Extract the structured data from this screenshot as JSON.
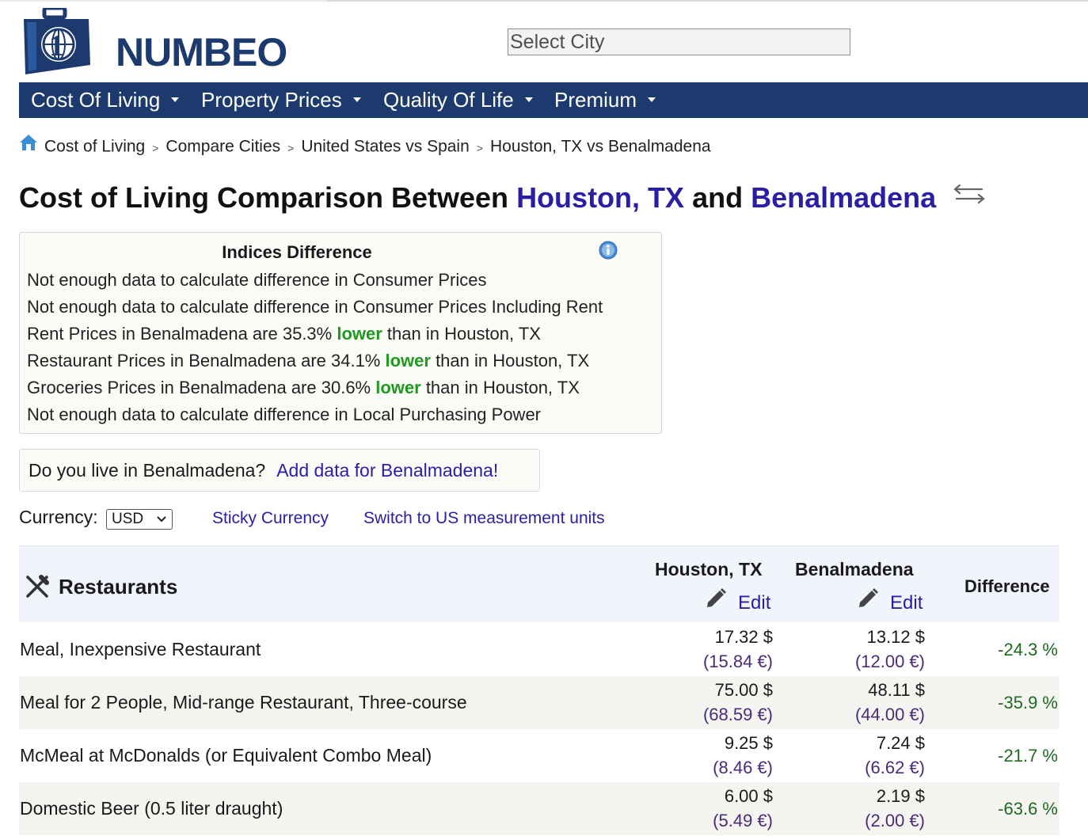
{
  "header": {
    "logo_text": "NUMBEO",
    "search_placeholder": "Select City"
  },
  "nav": {
    "items": [
      {
        "label": "Cost Of Living"
      },
      {
        "label": "Property Prices"
      },
      {
        "label": "Quality Of Life"
      },
      {
        "label": "Premium"
      }
    ]
  },
  "breadcrumb": {
    "items": [
      "Cost of Living",
      "Compare Cities",
      "United States vs Spain",
      "Houston, TX vs Benalmadena"
    ]
  },
  "title": {
    "prefix": "Cost of Living Comparison Between",
    "city1": "Houston, TX",
    "joiner": "and",
    "city2": "Benalmadena"
  },
  "indices": {
    "heading": "Indices Difference",
    "lines": [
      {
        "before": "Not enough data to calculate difference in Consumer Prices",
        "highlight": "",
        "after": ""
      },
      {
        "before": "Not enough data to calculate difference in Consumer Prices Including Rent",
        "highlight": "",
        "after": ""
      },
      {
        "before": "Rent Prices in Benalmadena are 35.3% ",
        "highlight": "lower",
        "after": " than in Houston, TX"
      },
      {
        "before": "Restaurant Prices in Benalmadena are 34.1% ",
        "highlight": "lower",
        "after": " than in Houston, TX"
      },
      {
        "before": "Groceries Prices in Benalmadena are 30.6% ",
        "highlight": "lower",
        "after": " than in Houston, TX"
      },
      {
        "before": "Not enough data to calculate difference in Local Purchasing Power",
        "highlight": "",
        "after": ""
      }
    ]
  },
  "live": {
    "question": "Do you live in Benalmadena?",
    "link": "Add data for Benalmadena!"
  },
  "currency": {
    "label": "Currency:",
    "selected": "USD",
    "sticky_link": "Sticky Currency",
    "units_link": "Switch to US measurement units"
  },
  "table": {
    "category": "Restaurants",
    "city1": "Houston, TX",
    "city2": "Benalmadena",
    "edit_label": "Edit",
    "difference_label": "Difference",
    "rows": [
      {
        "item": "Meal, Inexpensive Restaurant",
        "c1_usd": "17.32 $",
        "c1_eur": "(15.84 €)",
        "c2_usd": "13.12 $",
        "c2_eur": "(12.00 €)",
        "diff": "-24.3 %"
      },
      {
        "item": "Meal for 2 People, Mid-range Restaurant, Three-course",
        "c1_usd": "75.00 $",
        "c1_eur": "(68.59 €)",
        "c2_usd": "48.11 $",
        "c2_eur": "(44.00 €)",
        "diff": "-35.9 %"
      },
      {
        "item": "McMeal at McDonalds (or Equivalent Combo Meal)",
        "c1_usd": "9.25 $",
        "c1_eur": "(8.46 €)",
        "c2_usd": "7.24 $",
        "c2_eur": "(6.62 €)",
        "diff": "-21.7 %"
      },
      {
        "item": "Domestic Beer (0.5 liter draught)",
        "c1_usd": "6.00 $",
        "c1_eur": "(5.49 €)",
        "c2_usd": "2.19 $",
        "c2_eur": "(2.00 €)",
        "diff": "-63.6 %"
      }
    ]
  },
  "colors": {
    "brand_navy": "#1d3a6e",
    "link_purple": "#2b1ea6",
    "lower_green": "#1f9a1f"
  }
}
